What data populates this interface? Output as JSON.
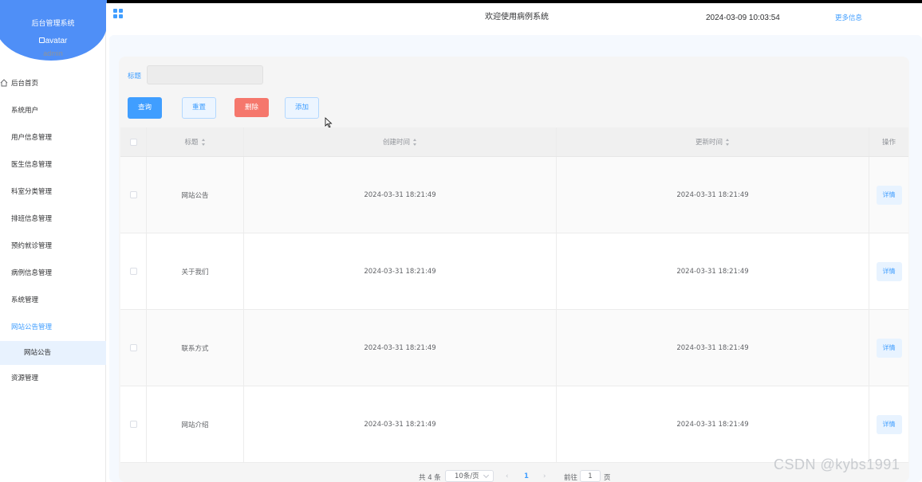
{
  "brand": {
    "title": "后台管理系统",
    "avatar_alt": "avatar",
    "username": "admin"
  },
  "header": {
    "title": "欢迎使用病例系统",
    "datetime": "2024-03-09 10:03:54",
    "more_info": "更多信息"
  },
  "sidebar": {
    "items": [
      {
        "label": "后台首页",
        "icon": "home-icon"
      },
      {
        "label": "系统用户"
      },
      {
        "label": "用户信息管理"
      },
      {
        "label": "医生信息管理"
      },
      {
        "label": "科室分类管理"
      },
      {
        "label": "排班信息管理"
      },
      {
        "label": "预约就诊管理"
      },
      {
        "label": "病例信息管理"
      },
      {
        "label": "系统管理"
      },
      {
        "label": "网站公告管理",
        "active": true
      },
      {
        "label": "网站公告",
        "sub": true,
        "selected": true
      },
      {
        "label": "资源管理"
      }
    ]
  },
  "search": {
    "label": "标题",
    "value": "",
    "placeholder": ""
  },
  "actions": {
    "query": "查询",
    "reset": "重置",
    "delete": "删除",
    "add": "添加"
  },
  "table": {
    "columns": [
      "标题",
      "创建时间",
      "更新时间",
      "操作"
    ],
    "rows": [
      {
        "title": "网站公告",
        "created": "2024-03-31 18:21:49",
        "updated": "2024-03-31 18:21:49",
        "action": "详情"
      },
      {
        "title": "关于我们",
        "created": "2024-03-31 18:21:49",
        "updated": "2024-03-31 18:21:49",
        "action": "详情"
      },
      {
        "title": "联系方式",
        "created": "2024-03-31 18:21:49",
        "updated": "2024-03-31 18:21:49",
        "action": "详情"
      },
      {
        "title": "网站介绍",
        "created": "2024-03-31 18:21:49",
        "updated": "2024-03-31 18:21:49",
        "action": "详情"
      }
    ]
  },
  "pagination": {
    "total": "共 4 条",
    "page_size": "10条/页",
    "prev": "‹",
    "current": "1",
    "next": "›",
    "goto_label": "前往",
    "goto_value": "1",
    "page_suffix": "页"
  },
  "watermark": "CSDN @kybs1991",
  "colors": {
    "accent": "#409eff",
    "brand_blue": "#4f8ff7",
    "danger": "#f5776c"
  }
}
